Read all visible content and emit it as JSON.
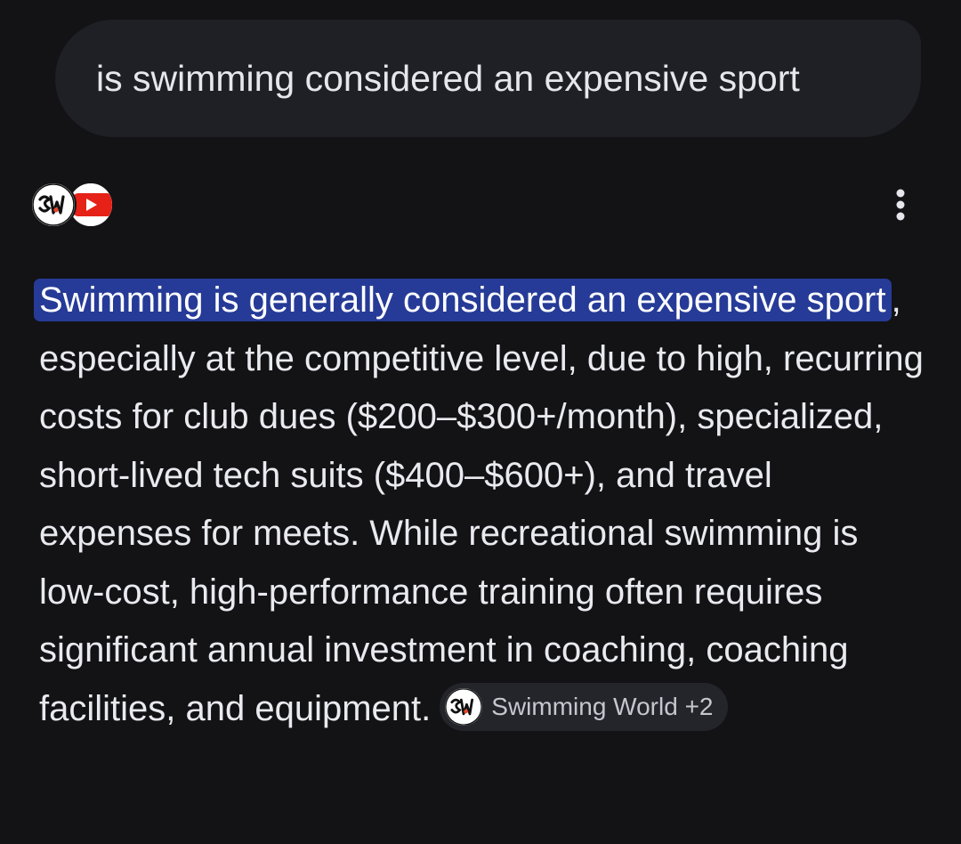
{
  "query": {
    "text": "is swimming considered an expensive sport"
  },
  "sources": [
    {
      "icon": "swimming-world-icon"
    },
    {
      "icon": "youtube-icon"
    }
  ],
  "actions": {
    "more_icon": "more-vert-icon"
  },
  "answer": {
    "highlight": "Swimming is generally considered an expensive sport",
    "body": ", especially at the competitive level, due to high, recurring costs for club dues ($200–$300+/month), specialized, short-lived tech suits ($400–$600+), and travel expenses for meets. While recreational swimming is low-cost, high-performance training often requires significant annual investment in coaching, coaching facilities, and equipment."
  },
  "citation": {
    "label": "Swimming World +2",
    "icon": "swimming-world-icon"
  },
  "colors": {
    "background": "#131316",
    "query_bubble": "#1f2026",
    "highlight": "#263b97",
    "chip": "#24252b",
    "youtube_red": "#e62117"
  }
}
